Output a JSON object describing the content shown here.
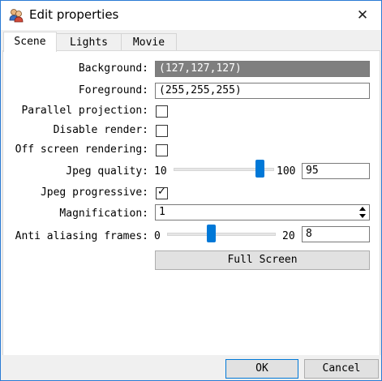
{
  "window": {
    "title": "Edit properties",
    "app_icon": "app-people-icon",
    "close_glyph": "✕",
    "accent_color": "#0078d7"
  },
  "tabs": [
    {
      "label": "Scene",
      "active": true
    },
    {
      "label": "Lights",
      "active": false
    },
    {
      "label": "Movie",
      "active": false
    }
  ],
  "scene": {
    "background": {
      "label": "Background:",
      "value": "(127,127,127)",
      "swatch_color": "#7f7f7f"
    },
    "foreground": {
      "label": "Foreground:",
      "value": "(255,255,255)",
      "swatch_color": "#ffffff"
    },
    "parallel_projection": {
      "label": "Parallel projection:",
      "checked": false
    },
    "disable_render": {
      "label": "Disable render:",
      "checked": false
    },
    "off_screen_rendering": {
      "label": "Off screen rendering:",
      "checked": false
    },
    "jpeg_quality": {
      "label": "Jpeg quality:",
      "min": "10",
      "max": "100",
      "value": "95",
      "slider_value": 95
    },
    "jpeg_progressive": {
      "label": "Jpeg progressive:",
      "checked": true,
      "check_glyph": "✓"
    },
    "magnification": {
      "label": "Magnification:",
      "value": "1"
    },
    "anti_aliasing_frames": {
      "label": "Anti aliasing frames:",
      "min": "0",
      "max": "20",
      "value": "8",
      "slider_value": 8
    },
    "full_screen_label": "Full Screen"
  },
  "buttons": {
    "ok": "OK",
    "cancel": "Cancel"
  }
}
